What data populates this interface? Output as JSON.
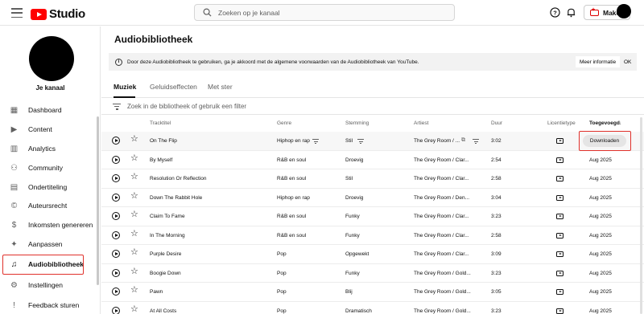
{
  "header": {
    "logo_text": "Studio",
    "search_placeholder": "Zoeken op je kanaal",
    "create_label": "Maken"
  },
  "sidebar": {
    "channel_label": "Je kanaal",
    "items": [
      {
        "label": "Dashboard",
        "icon": "dashboard-icon"
      },
      {
        "label": "Content",
        "icon": "content-icon"
      },
      {
        "label": "Analytics",
        "icon": "analytics-icon"
      },
      {
        "label": "Community",
        "icon": "community-icon"
      },
      {
        "label": "Ondertiteling",
        "icon": "subtitles-icon"
      },
      {
        "label": "Auteursrecht",
        "icon": "copyright-icon"
      },
      {
        "label": "Inkomsten genereren",
        "icon": "dollar-icon"
      },
      {
        "label": "Aanpassen",
        "icon": "wand-icon"
      },
      {
        "label": "Audiobibliotheek",
        "icon": "audio-library-icon",
        "active": true
      },
      {
        "label": "Instellingen",
        "icon": "gear-icon"
      },
      {
        "label": "Feedback sturen",
        "icon": "feedback-icon"
      }
    ]
  },
  "main": {
    "title": "Audiobibliotheek",
    "banner": {
      "text": "Door deze Audiobibliotheek te gebruiken, ga je akkoord met de algemene voorwaarden van de Audiobibliotheek van YouTube.",
      "more_info": "Meer informatie",
      "ok": "OK"
    },
    "tabs": [
      "Muziek",
      "Geluidseffecten",
      "Met ster"
    ],
    "filter_placeholder": "Zoek in de bibliotheek of gebruik een filter",
    "columns": {
      "track": "Tracktitel",
      "genre": "Genre",
      "mood": "Stemming",
      "artist": "Artiest",
      "duration": "Duur",
      "license": "Licentietype",
      "added": "Toegevoegd",
      "sort_arrow": "↓"
    },
    "download_label": "Downloaden",
    "rows": [
      {
        "title": "On The Flip",
        "genre": "Hiphop en rap",
        "mood": "Stil",
        "artist": "The Grey Room / ...",
        "duration": "3:02",
        "added": ""
      },
      {
        "title": "By Myself",
        "genre": "R&B en soul",
        "mood": "Droevig",
        "artist": "The Grey Room / Clar...",
        "duration": "2:54",
        "added": "Aug 2025"
      },
      {
        "title": "Resolution Or Reflection",
        "genre": "R&B en soul",
        "mood": "Stil",
        "artist": "The Grey Room / Clar...",
        "duration": "2:58",
        "added": "Aug 2025"
      },
      {
        "title": "Down The Rabbit Hole",
        "genre": "Hiphop en rap",
        "mood": "Droevig",
        "artist": "The Grey Room / Den...",
        "duration": "3:04",
        "added": "Aug 2025"
      },
      {
        "title": "Claim To Fame",
        "genre": "R&B en soul",
        "mood": "Funky",
        "artist": "The Grey Room / Clar...",
        "duration": "3:23",
        "added": "Aug 2025"
      },
      {
        "title": "In The Morning",
        "genre": "R&B en soul",
        "mood": "Funky",
        "artist": "The Grey Room / Clar...",
        "duration": "2:58",
        "added": "Aug 2025"
      },
      {
        "title": "Purple Desire",
        "genre": "Pop",
        "mood": "Opgewekt",
        "artist": "The Grey Room / Clar...",
        "duration": "3:09",
        "added": "Aug 2025"
      },
      {
        "title": "Boogie Down",
        "genre": "Pop",
        "mood": "Funky",
        "artist": "The Grey Room / Gold...",
        "duration": "3:23",
        "added": "Aug 2025"
      },
      {
        "title": "Pawn",
        "genre": "Pop",
        "mood": "Blij",
        "artist": "The Grey Room / Gold...",
        "duration": "3:05",
        "added": "Aug 2025"
      },
      {
        "title": "At All Costs",
        "genre": "Pop",
        "mood": "Dramatisch",
        "artist": "The Grey Room / Gold...",
        "duration": "3:23",
        "added": "Aug 2025"
      }
    ]
  }
}
